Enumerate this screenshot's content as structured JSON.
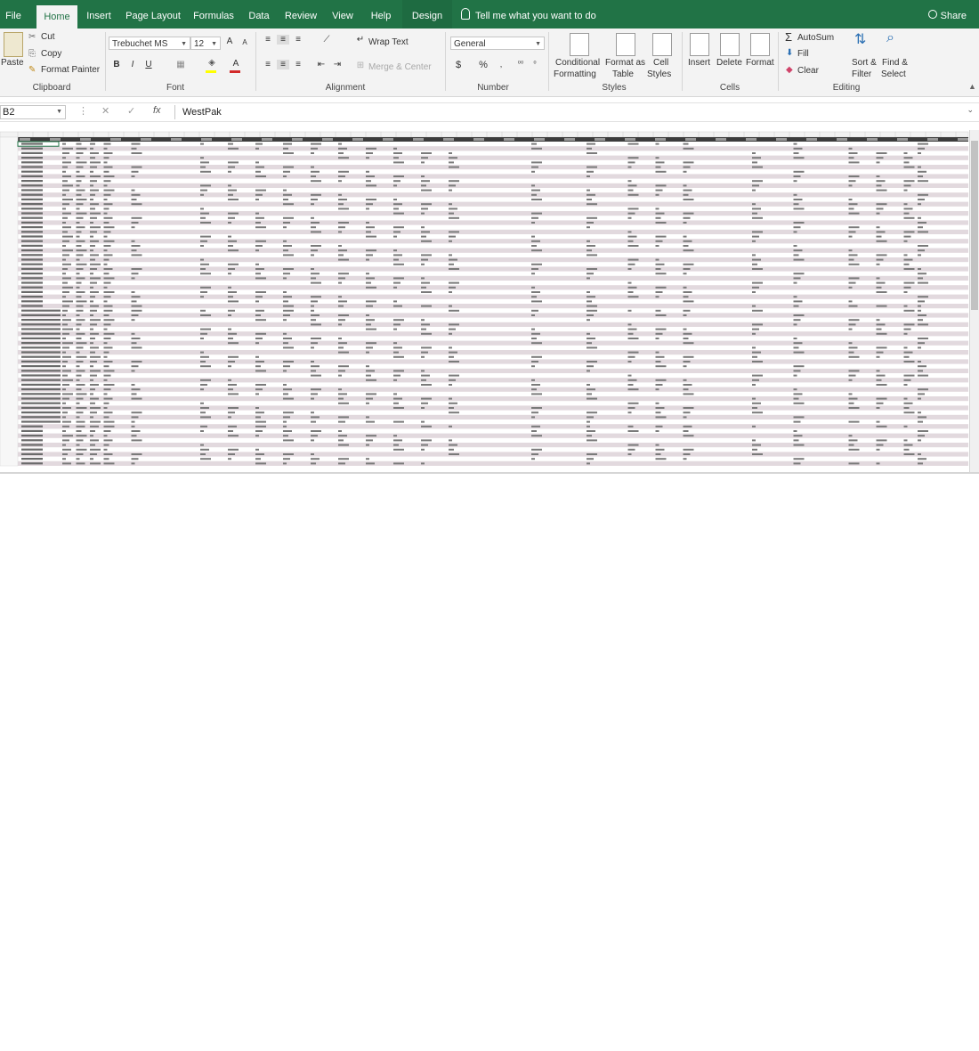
{
  "tabs": {
    "file": "File",
    "home": "Home",
    "insert": "Insert",
    "page_layout": "Page Layout",
    "formulas": "Formulas",
    "data": "Data",
    "review": "Review",
    "view": "View",
    "help": "Help",
    "design": "Design",
    "tell_me": "Tell me what you want to do",
    "share": "Share"
  },
  "ribbon": {
    "clipboard": {
      "label": "Clipboard",
      "paste": "Paste",
      "cut": "Cut",
      "copy": "Copy",
      "format_painter": "Format Painter"
    },
    "font": {
      "label": "Font",
      "family": "Trebuchet MS",
      "size": "12",
      "bold": "B",
      "italic": "I",
      "underline": "U"
    },
    "alignment": {
      "label": "Alignment",
      "wrap_text": "Wrap Text",
      "merge_center": "Merge & Center"
    },
    "number": {
      "label": "Number",
      "format": "General",
      "currency": "$",
      "percent": "%"
    },
    "styles": {
      "label": "Styles",
      "conditional": "Conditional",
      "conditional2": "Formatting",
      "format_as": "Format as",
      "format_as2": "Table",
      "cell": "Cell",
      "cell2": "Styles"
    },
    "cells": {
      "label": "Cells",
      "insert": "Insert",
      "delete": "Delete",
      "format": "Format"
    },
    "editing": {
      "label": "Editing",
      "autosum": "AutoSum",
      "fill": "Fill",
      "clear": "Clear",
      "sort": "Sort &",
      "sort2": "Filter",
      "find": "Find &",
      "find2": "Select"
    }
  },
  "formula_bar": {
    "name_box": "B2",
    "cancel": "✕",
    "enter": "✓",
    "fx": "fx",
    "value": "WestPak"
  },
  "sheet": {
    "customers": [
      "WestPak",
      "Avocado Selling Comp...",
      "Mission"
    ],
    "row_groups": [
      {
        "customer_index": 0,
        "row_count": 36
      },
      {
        "customer_index": 1,
        "row_count": 25
      },
      {
        "customer_index": 2,
        "row_count": 9
      }
    ]
  },
  "colors": {
    "accent": "#217346",
    "accent_dark": "#1e6b41",
    "ribbon_bg": "#f3f3f3",
    "banded_row": "#e2d9de",
    "header_row": "#3c3c3c"
  }
}
